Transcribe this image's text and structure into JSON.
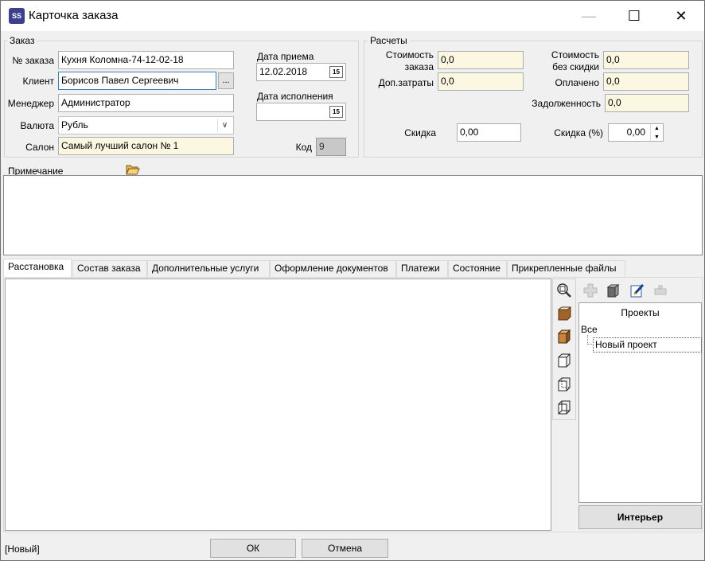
{
  "window": {
    "title": "Карточка заказа",
    "minimize": "—",
    "maximize": "☐",
    "close": "✕"
  },
  "order": {
    "group_label": "Заказ",
    "order_no_label": "№ заказа",
    "order_no": "Кухня Коломна-74-12-02-18",
    "client_label": "Клиент",
    "client": "Борисов Павел Сергеевич",
    "client_browse": "...",
    "manager_label": "Менеджер",
    "manager": "Администратор",
    "currency_label": "Валюта",
    "currency": "Рубль",
    "salon_label": "Салон",
    "salon": "Самый лучший салон № 1",
    "date_received_label": "Дата приема",
    "date_received": "12.02.2018",
    "date_done_label": "Дата исполнения",
    "date_done": "",
    "code_label": "Код",
    "code": "9",
    "calendar_icon_text": "15"
  },
  "calc": {
    "group_label": "Расчеты",
    "cost_label_1": "Стоимость",
    "cost_label_2": "заказа",
    "cost": "0,0",
    "extra_label": "Доп.затраты",
    "extra": "0,0",
    "cost_nodisc_label_1": "Стоимость",
    "cost_nodisc_label_2": "без скидки",
    "cost_nodisc": "0,0",
    "paid_label": "Оплачено",
    "paid": "0,0",
    "debt_label": "Задолженность",
    "debt": "0,0",
    "discount_label": "Скидка",
    "discount": "0,00",
    "discount_pct_label": "Скидка (%)",
    "discount_pct": "0,00"
  },
  "note": {
    "label": "Примечание",
    "text": ""
  },
  "tabs": [
    {
      "label": "Расстановка"
    },
    {
      "label": "Состав заказа"
    },
    {
      "label": "Дополнительные услуги"
    },
    {
      "label": "Оформление документов"
    },
    {
      "label": "Платежи"
    },
    {
      "label": "Состояние"
    },
    {
      "label": "Прикрепленные файлы"
    }
  ],
  "projects": {
    "header": "Проекты",
    "root": "Все",
    "items": [
      {
        "label": "Новый проект"
      }
    ],
    "interior_button": "Интерьер"
  },
  "footer": {
    "status": "[Новый]",
    "ok": "ОК",
    "cancel": "Отмена"
  },
  "colors": {
    "accent": "#3b3f8c",
    "readonly_bg": "#fbf7e1",
    "window_bg": "#f0f0f0"
  }
}
